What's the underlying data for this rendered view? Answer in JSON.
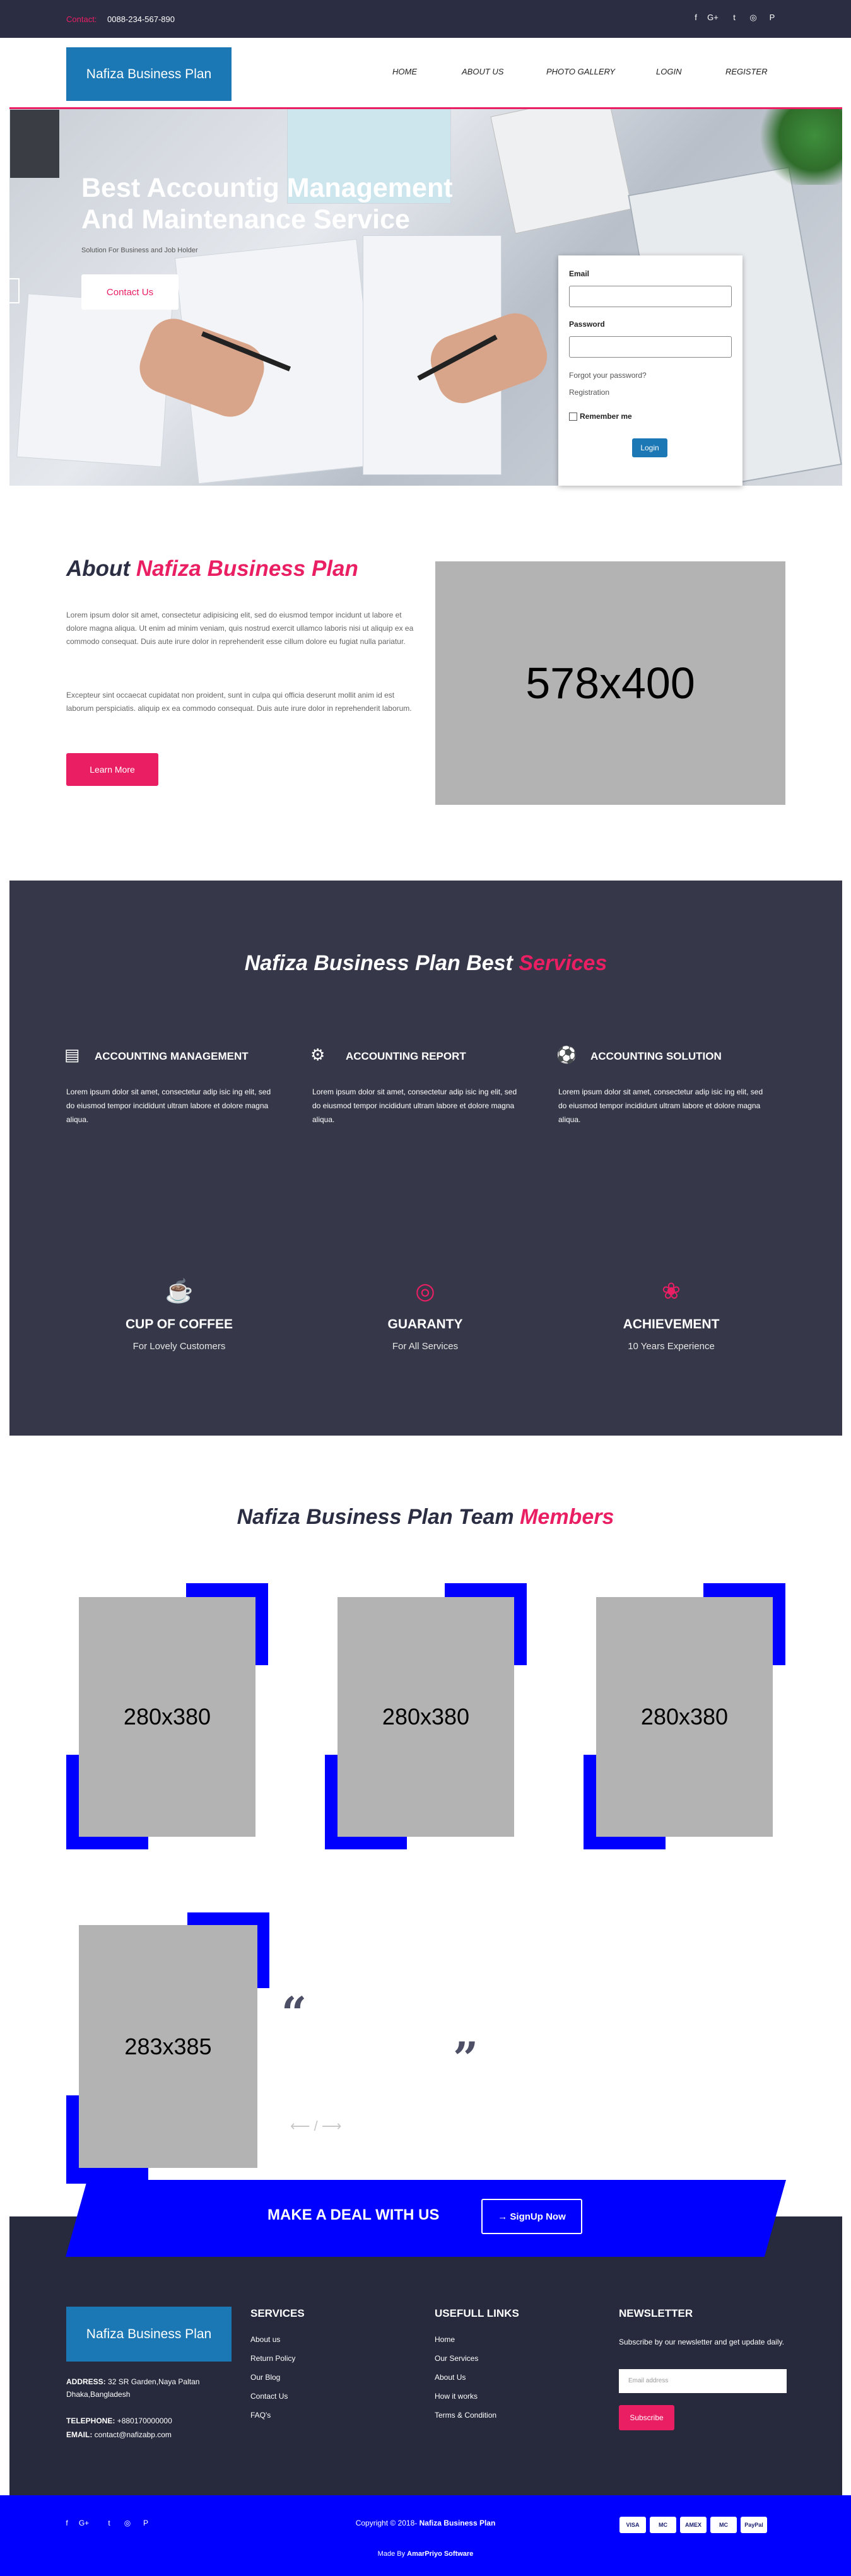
{
  "topbar": {
    "contact_label": "Contact:",
    "phone": "0088-234-567-890",
    "social": [
      "f",
      "G+",
      "t",
      "◎",
      "P"
    ]
  },
  "header": {
    "logo": "Nafiza Business Plan",
    "nav": [
      "HOME",
      "ABOUT US",
      "PHOTO GALLERY",
      "LOGIN",
      "REGISTER"
    ]
  },
  "hero": {
    "title_line1": "Best Accountig Management",
    "title_line2": "And Maintenance Service",
    "subtitle": "Solution For Business and Job Holder",
    "button": "Contact Us"
  },
  "login": {
    "email_label": "Email",
    "password_label": "Password",
    "forgot": "Forgot your password?",
    "registration": "Registration",
    "remember": "Remember me",
    "button": "Login"
  },
  "about": {
    "title_prefix": "About",
    "title_highlight": "Nafiza Business Plan",
    "para1": "Lorem ipsum dolor sit amet, consectetur adipisicing elit, sed do eiusmod tempor incidunt ut labore et dolore magna aliqua. Ut enim ad minim veniam, quis nostrud exercit ullamco laboris nisi ut aliquip ex ea commodo consequat. Duis aute irure dolor in reprehenderit esse cillum dolore eu fugiat nulla pariatur.",
    "para2": "Excepteur sint occaecat cupidatat non proident, sunt in culpa qui officia deserunt mollit anim id est laborum perspiciatis. aliquip ex ea commodo consequat. Duis aute irure dolor in reprehenderit laborum.",
    "button": "Learn More",
    "image_placeholder": "578x400"
  },
  "services": {
    "title_prefix": "Nafiza Business Plan Best",
    "title_highlight": "Services",
    "items": [
      {
        "title": "ACCOUNTING MANAGEMENT",
        "icon": "building-icon",
        "text": "Lorem ipsum dolor sit amet, consectetur adip isic ing elit, sed do eiusmod tempor incididunt ultram labore et dolore magna aliqua."
      },
      {
        "title": "ACCOUNTING REPORT",
        "icon": "gears-icon",
        "text": "Lorem ipsum dolor sit amet, consectetur adip isic ing elit, sed do eiusmod tempor incididunt ultram labore et dolore magna aliqua."
      },
      {
        "title": "ACCOUNTING SOLUTION",
        "icon": "soccer-ball-icon",
        "text": "Lorem ipsum dolor sit amet, consectetur adip isic ing elit, sed do eiusmod tempor incididunt ultram labore et dolore magna aliqua."
      }
    ],
    "stats": [
      {
        "title": "CUP OF COFFEE",
        "sub": "For Lovely Customers",
        "icon": "coffee-cup-icon"
      },
      {
        "title": "GUARANTY",
        "sub": "For All Services",
        "icon": "target-icon"
      },
      {
        "title": "ACHIEVEMENT",
        "sub": "10 Years Experience",
        "icon": "award-icon"
      }
    ]
  },
  "team": {
    "title_prefix": "Nafiza Business Plan Team",
    "title_highlight": "Members",
    "members": [
      "280x380",
      "280x380",
      "280x380"
    ]
  },
  "testimonial": {
    "image_placeholder": "283x385",
    "arrows": "⟵ / ⟶"
  },
  "cta": {
    "text": "MAKE A DEAL WITH US",
    "button": "→ SignUp Now"
  },
  "footer": {
    "logo": "Nafiza Business Plan",
    "address_label": "ADDRESS:",
    "address": "32 SR Garden,Naya Paltan Dhaka,Bangladesh",
    "telephone_label": "TELEPHONE:",
    "telephone": "+880170000000",
    "email_label": "EMAIL:",
    "email": "contact@nafizabp.com",
    "services_title": "SERVICES",
    "services_links": [
      "About us",
      "Return Policy",
      "Our Blog",
      "Contact Us",
      "FAQ's"
    ],
    "useful_title": "USEFULL LINKS",
    "useful_links": [
      "Home",
      "Our Services",
      "About Us",
      "How it works",
      "Terms & Condition"
    ],
    "newsletter_title": "NEWSLETTER",
    "newsletter_text": "Subscribe by our newsletter and get update daily.",
    "newsletter_placeholder": "Email address",
    "newsletter_button": "Subscribe"
  },
  "bottom": {
    "social": [
      "f",
      "G+",
      "t",
      "◎",
      "P"
    ],
    "copyright_prefix": "Copyright © 2018-",
    "copyright_brand": "Nafiza Business Plan",
    "madeby_prefix": "Made By",
    "madeby_brand": "AmarPriyo Software",
    "payments": [
      "VISA",
      "MC",
      "AMEX",
      "MC",
      "PayPal"
    ]
  }
}
